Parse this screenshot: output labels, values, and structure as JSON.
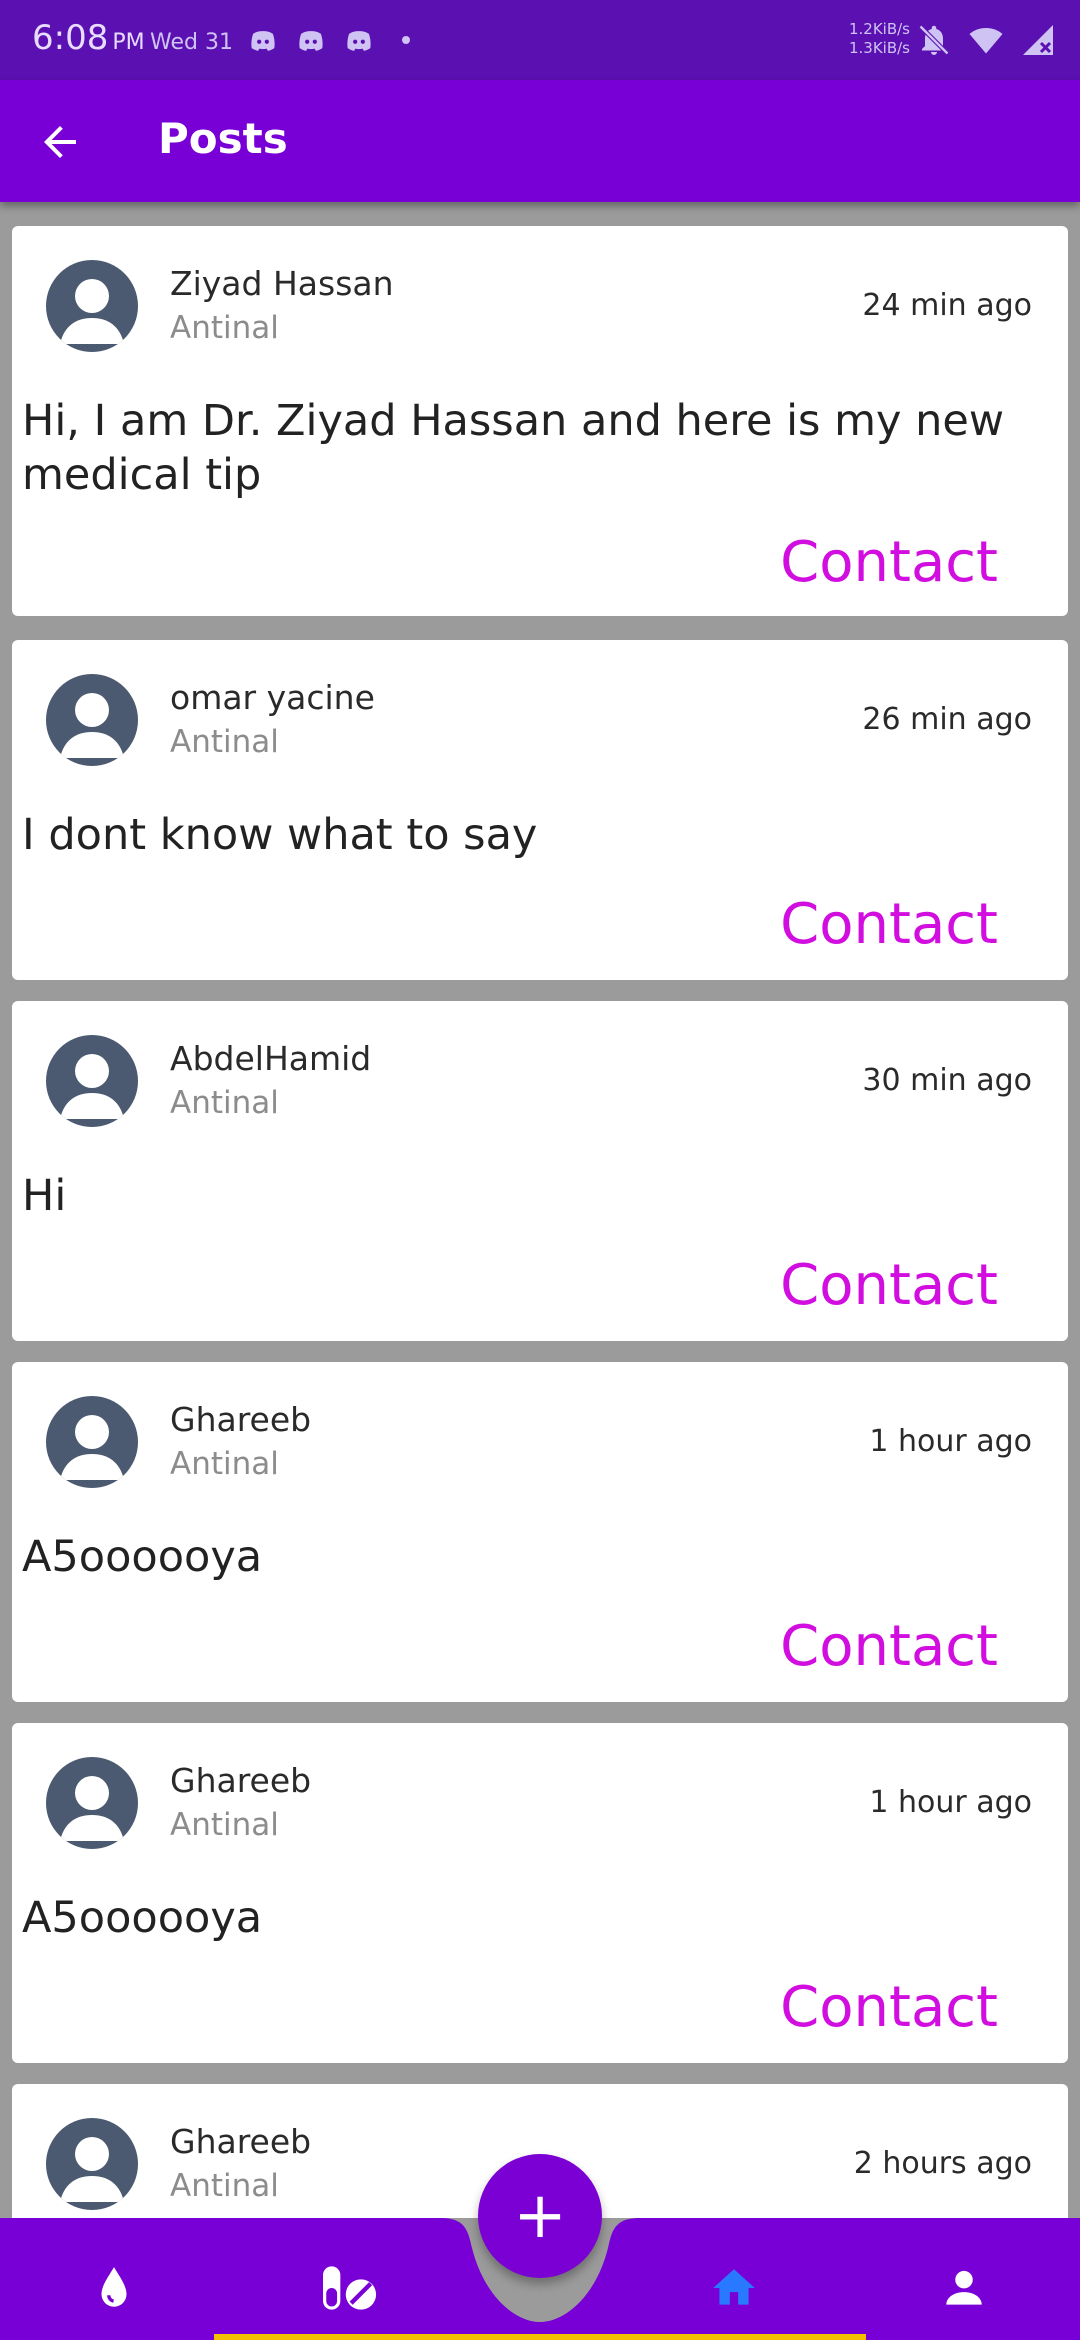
{
  "status_bar": {
    "time": "6:08",
    "ampm": "PM",
    "date": "Wed 31",
    "net_up": "1.2KiB/s",
    "net_down": "1.3KiB/s",
    "icons": [
      "discord-icon",
      "discord-icon",
      "discord-icon",
      "mute-icon",
      "wifi-icon",
      "signal-icon"
    ]
  },
  "appbar": {
    "title": "Posts",
    "back_icon": "arrow-left-icon"
  },
  "posts": [
    {
      "author": "Ziyad Hassan",
      "role": "Antinal",
      "time": "24 min ago",
      "text": "Hi, I am Dr. Ziyad Hassan and here is my new medical tip",
      "action": "Contact"
    },
    {
      "author": "omar yacine",
      "role": "Antinal",
      "time": "26 min ago",
      "text": "I dont know what to say",
      "action": "Contact"
    },
    {
      "author": "AbdelHamid",
      "role": "Antinal",
      "time": "30 min ago",
      "text": "Hi",
      "action": "Contact"
    },
    {
      "author": "Ghareeb",
      "role": "Antinal",
      "time": "1 hour ago",
      "text": "A5oooooya",
      "action": "Contact"
    },
    {
      "author": "Ghareeb",
      "role": "Antinal",
      "time": "1 hour ago",
      "text": "A5oooooya",
      "action": "Contact"
    },
    {
      "author": "Ghareeb",
      "role": "Antinal",
      "time": "2 hours ago",
      "text": "",
      "action": ""
    }
  ],
  "bottom_nav": {
    "fab_label": "+",
    "items": [
      "drop-icon",
      "pills-icon",
      "home-icon",
      "person-icon"
    ],
    "active": "home-icon",
    "colors": {
      "bar": "#7800d6",
      "active": "#2979ff",
      "inactive": "#ffffff"
    }
  },
  "colors": {
    "primary": "#7800d6",
    "status_bar": "#5b10b2",
    "contact": "#d10edf",
    "avatar": "#4b5a70"
  }
}
